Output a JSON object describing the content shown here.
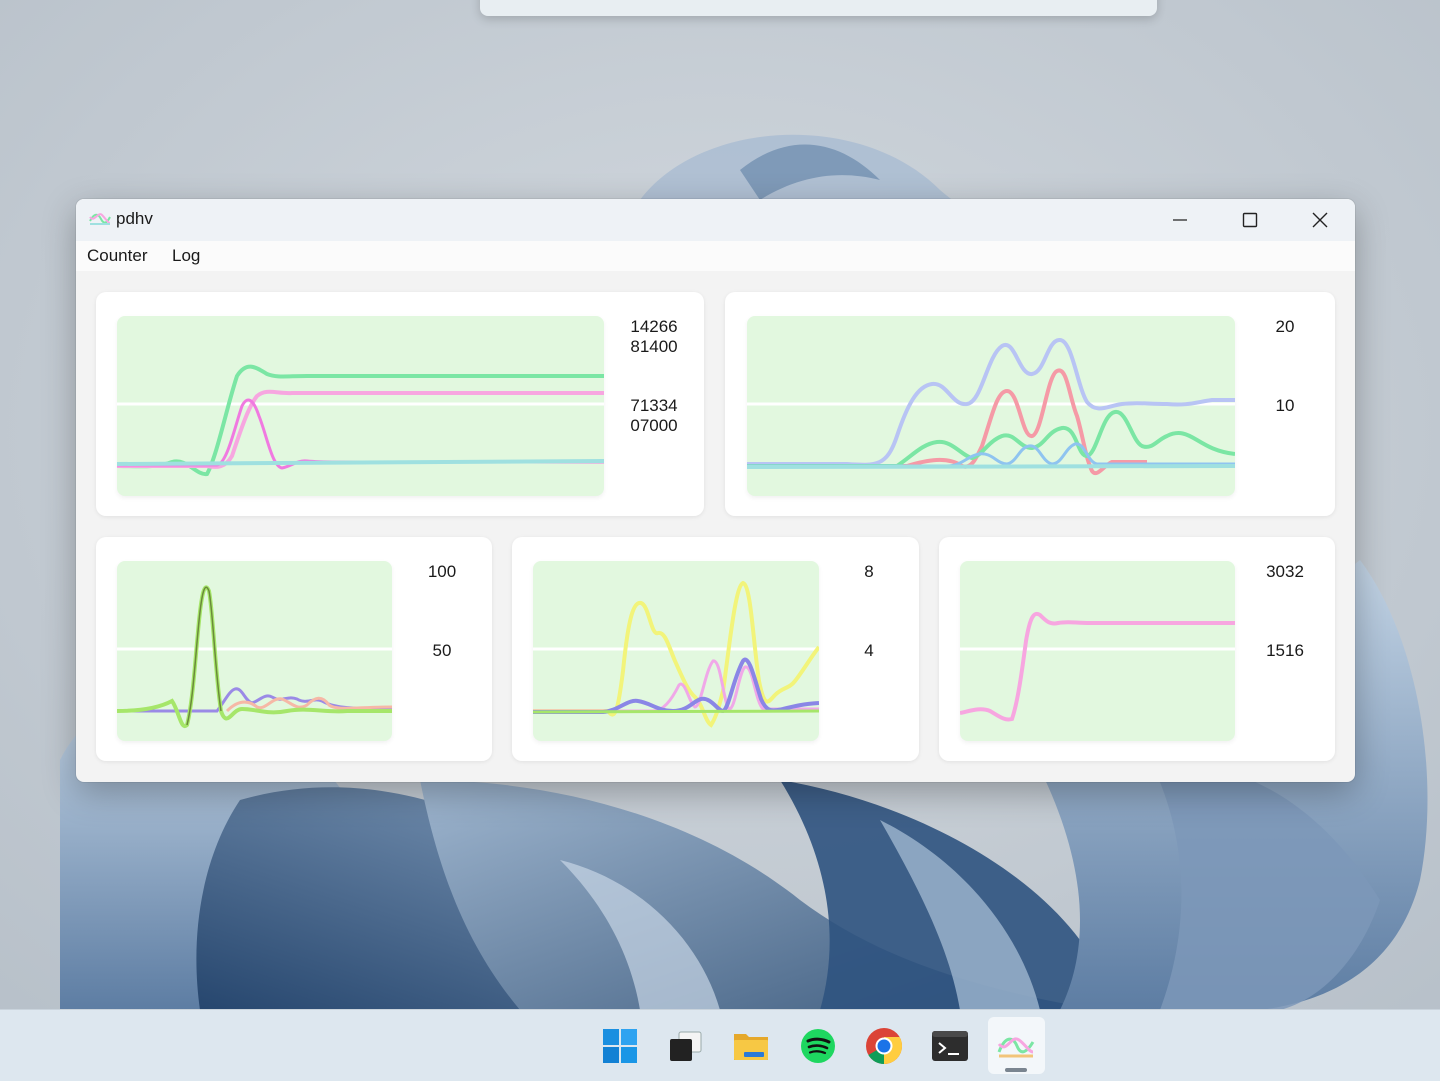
{
  "window": {
    "title": "pdhv",
    "controls": {
      "minimize": "minimize",
      "maximize": "maximize",
      "close": "close"
    }
  },
  "menu": {
    "items": [
      "Counter",
      "Log"
    ]
  },
  "panels": [
    {
      "labels": [
        "14266\n81400",
        "71334\n07000"
      ]
    },
    {
      "labels": [
        "20",
        "10"
      ]
    },
    {
      "labels": [
        "100",
        "50"
      ]
    },
    {
      "labels": [
        "8",
        "4"
      ]
    },
    {
      "labels": [
        "3032",
        "1516"
      ]
    }
  ],
  "colors": {
    "plot_bg": "#e2f8df",
    "green": "#7be6a4",
    "pink": "#f7a6e0",
    "teal": "#9fe0e0",
    "lavender": "#b8c4f4",
    "salmon": "#f59aa6",
    "lime": "#a6e66a",
    "purple": "#9a8ae6",
    "yellow": "#f2f47a",
    "peach": "#f6b8a6"
  },
  "taskbar": {
    "items": [
      "start-icon",
      "task-view-icon",
      "file-explorer-icon",
      "spotify-icon",
      "chrome-icon",
      "terminal-icon",
      "pdhv-app-icon"
    ]
  }
}
